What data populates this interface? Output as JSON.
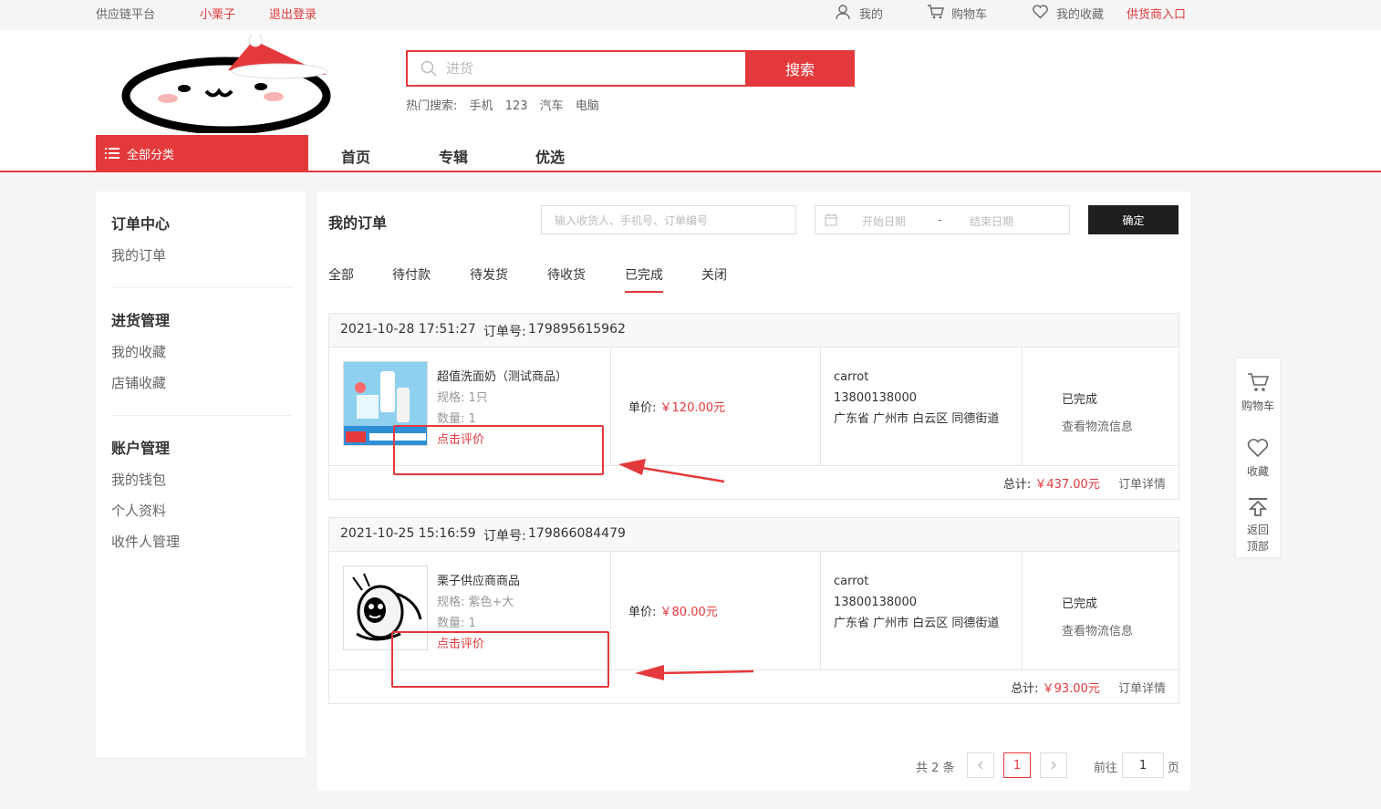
{
  "topbar": {
    "platform": "供应链平台",
    "username": "小栗子",
    "logout": "退出登录",
    "mine": "我的",
    "cart": "购物车",
    "favorites": "我的收藏",
    "supplier_entry": "供货商入口"
  },
  "search": {
    "placeholder": "进货",
    "button": "搜索",
    "hot_label": "热门搜索:",
    "hot_terms": [
      "手机",
      "123",
      "汽车",
      "电脑"
    ]
  },
  "nav": {
    "all_categories": "全部分类",
    "items": [
      "首页",
      "专辑",
      "优选"
    ]
  },
  "sidebar": {
    "sections": [
      {
        "title": "订单中心",
        "items": [
          "我的订单"
        ]
      },
      {
        "title": "进货管理",
        "items": [
          "我的收藏",
          "店铺收藏"
        ]
      },
      {
        "title": "账户管理",
        "items": [
          "我的钱包",
          "个人资料",
          "收件人管理"
        ]
      }
    ]
  },
  "orders_page": {
    "title": "我的订单",
    "keyword_placeholder": "输入收货人、手机号、订单编号",
    "start_date_placeholder": "开始日期",
    "date_sep": "-",
    "end_date_placeholder": "结束日期",
    "confirm": "确定",
    "tabs": [
      "全部",
      "待付款",
      "待发货",
      "待收货",
      "已完成",
      "关闭"
    ],
    "active_tab": "已完成"
  },
  "orders": [
    {
      "datetime": "2021-10-28 17:51:27",
      "order_no_label": "订单号:",
      "order_no": "179895615962",
      "product_name": "超值洗面奶（测试商品）",
      "spec": "规格: 1只",
      "qty": "数量: 1",
      "review": "点击评价",
      "price_label": "单价:",
      "price": "￥120.00元",
      "receiver": "carrot",
      "phone": "13800138000",
      "address": "广东省 广州市 白云区 同德街道",
      "status": "已完成",
      "logistics": "查看物流信息",
      "total_label": "总计:",
      "total": "￥437.00元",
      "detail": "订单详情"
    },
    {
      "datetime": "2021-10-25 15:16:59",
      "order_no_label": "订单号:",
      "order_no": "179866084479",
      "product_name": "栗子供应商商品",
      "spec": "规格: 紫色+大",
      "qty": "数量: 1",
      "review": "点击评价",
      "price_label": "单价:",
      "price": "￥80.00元",
      "receiver": "carrot",
      "phone": "13800138000",
      "address": "广东省 广州市 白云区 同德街道",
      "status": "已完成",
      "logistics": "查看物流信息",
      "total_label": "总计:",
      "total": "￥93.00元",
      "detail": "订单详情"
    }
  ],
  "pagination": {
    "total_text": "共 2 条",
    "current_page": "1",
    "goto_label": "前往",
    "goto_value": "1",
    "page_suffix": "页"
  },
  "float_bar": {
    "cart": "购物车",
    "favorites": "收藏",
    "back_top_line1": "返回",
    "back_top_line2": "顶部"
  },
  "colors": {
    "accent": "#e4393c",
    "dark_button": "#1f1f1f"
  }
}
